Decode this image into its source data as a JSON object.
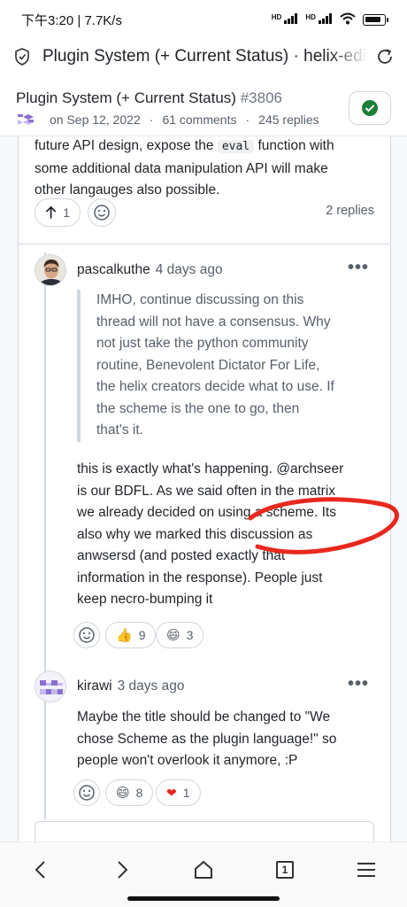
{
  "status_bar": {
    "time": "下午3:20",
    "speed": "7.7K/s",
    "signal1": "HD",
    "signal2": "HD"
  },
  "browser": {
    "title": "Plugin System (+ Current Status) · helix-editor"
  },
  "issue": {
    "title": "Plugin System (+ Current Status)",
    "number": "#3806",
    "date": "on Sep 12, 2022",
    "comments": "61 comments",
    "replies": "245 replies"
  },
  "top_comment": {
    "line1a": "future API design, expose the",
    "code": "eval",
    "line1b": "function with",
    "line2": "some additional data manipulation API will make",
    "line3": "other langauges also possible.",
    "upvotes": "1",
    "replies_label": "2 replies"
  },
  "reply1": {
    "author": "pascalkuthe",
    "time": "4 days ago",
    "quote_lines": [
      "IMHO, continue discussing on this",
      "thread will not have a consensus. Why",
      "not just take the python community",
      "routine, Benevolent Dictator For Life,",
      "the helix creators decide what to use. If",
      "the scheme is the one to go, then",
      "that's it."
    ],
    "body_lines": [
      "this is exactly what's happening. @archseer",
      "is our BDFL. As we said often in the matrix",
      "we already decided on using a scheme. Its",
      "also why we marked this discussion as",
      "anwsersd (and posted exactly that",
      "information in the response). People just",
      "keep necro-bumping it"
    ],
    "thumbs": "9",
    "smile": "3"
  },
  "reply2": {
    "author": "kirawi",
    "time": "3 days ago",
    "body_lines": [
      "Maybe the title should be changed to \"We",
      "chose Scheme as the plugin language!\" so",
      "people won't overlook it anymore, :P"
    ],
    "smile": "8",
    "heart": "1"
  },
  "bottom_nav": {
    "tabs_count": "1"
  },
  "colors": {
    "accent_green": "#1a7f37",
    "annotation_red": "#e8281e",
    "logo_purple": "#8a6fd1"
  }
}
